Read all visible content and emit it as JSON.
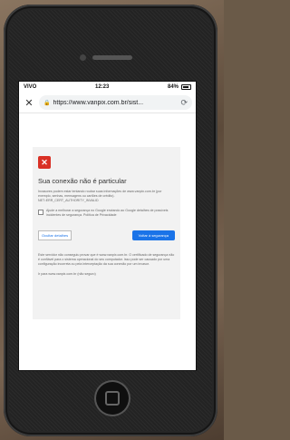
{
  "status_bar": {
    "carrier": "VIVO",
    "time": "12:23",
    "battery": "84%"
  },
  "browser": {
    "url": "https://www.vanpix.com.br/sist..."
  },
  "error_page": {
    "title": "Sua conexão não é particular",
    "description": "Invasores podem estar tentando roubar suas informações de www.vanpix.com.br (por exemplo, senhas, mensagens ou cartões de crédito). NET::ERR_CERT_AUTHORITY_INVALID",
    "checkbox_text": "Ajude a melhorar a segurança no Google enviando ao Google detalhes de possíveis incidentes de segurança. Política de Privacidade",
    "advanced_button": "Ocultar detalhes",
    "back_button": "Voltar à segurança",
    "details_text": "Este servidor não conseguiu provar que é www.vanpix.com.br. O certificado de segurança não é confiável para o sistema operacional do seu computador. Isso pode ser causado por uma configuração incorreta ou pela interceptação da sua conexão por um invasor.",
    "proceed_link": "Ir para www.vanpix.com.br (não seguro)"
  },
  "colors": {
    "danger": "#d93025",
    "link": "#1a73e8"
  }
}
